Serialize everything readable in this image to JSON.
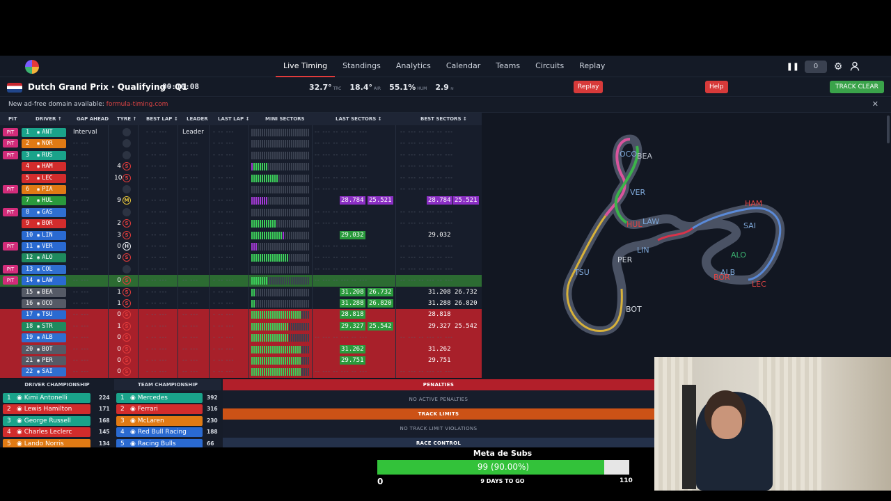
{
  "nav": {
    "links": [
      "Live Timing",
      "Standings",
      "Analytics",
      "Calendar",
      "Teams",
      "Circuits",
      "Replay"
    ],
    "active": "Live Timing",
    "counter": "0"
  },
  "session": {
    "title": "Dutch Grand Prix · Qualifying · Q1",
    "clock": "00:16:08",
    "track_temp": "32.7°",
    "track_label": "TRC",
    "air_temp": "18.4°",
    "air_label": "AIR",
    "humidity": "55.1%",
    "humidity_label": "HUM",
    "wind": "2.9",
    "replay_btn": "Replay",
    "help_btn": "Help",
    "flag_btn": "TRACK CLEAR"
  },
  "banner": {
    "text": "New ad-free domain available:",
    "link": "formula-timing.com"
  },
  "timing_headers": {
    "pit": "PIT",
    "driver": "DRIVER ↑",
    "gap": "GAP AHEAD",
    "tyre": "TYRE ↑",
    "best_lap": "BEST LAP ↕",
    "leader": "LEADER",
    "last_lap": "LAST LAP ↕",
    "mini": "MINI SECTORS",
    "last_sectors": "LAST SECTORS ↕",
    "best_sectors": "BEST SECTORS ↕"
  },
  "timing_rows": [
    {
      "pit": true,
      "pos": "1",
      "code": "ANT",
      "color": "#1aa38a",
      "gap": "Interval",
      "leader": "Leader",
      "laps": "",
      "tyre": "none",
      "mini": "",
      "ls": [
        "",
        ""
      ],
      "bs": [
        "",
        ""
      ],
      "row": ""
    },
    {
      "pit": true,
      "pos": "2",
      "code": "NOR",
      "color": "#e07a14",
      "gap": "",
      "leader": "",
      "laps": "",
      "tyre": "none",
      "mini": "",
      "ls": [
        "",
        ""
      ],
      "bs": [
        "",
        ""
      ],
      "row": ""
    },
    {
      "pit": true,
      "pos": "3",
      "code": "RUS",
      "color": "#1aa38a",
      "gap": "",
      "leader": "",
      "laps": "",
      "tyre": "none",
      "mini": "",
      "ls": [
        "",
        ""
      ],
      "bs": [
        "",
        ""
      ],
      "row": ""
    },
    {
      "pit": false,
      "pos": "4",
      "code": "HAM",
      "color": "#d22c2c",
      "gap": "",
      "leader": "",
      "laps": "4",
      "tyre": "S",
      "mini": "pggggggg",
      "ls": [
        "",
        ""
      ],
      "bs": [
        "",
        ""
      ],
      "row": ""
    },
    {
      "pit": false,
      "pos": "5",
      "code": "LEC",
      "color": "#d22c2c",
      "gap": "",
      "leader": "",
      "laps": "10",
      "tyre": "S",
      "mini": "ggggggggggggg",
      "ls": [
        "",
        ""
      ],
      "bs": [
        "",
        ""
      ],
      "row": ""
    },
    {
      "pit": true,
      "pos": "6",
      "code": "PIA",
      "color": "#e07a14",
      "gap": "",
      "leader": "",
      "laps": "",
      "tyre": "none",
      "mini": "",
      "ls": [
        "",
        ""
      ],
      "bs": [
        "",
        ""
      ],
      "row": ""
    },
    {
      "pit": false,
      "pos": "7",
      "code": "HUL",
      "color": "#2a9a3c",
      "gap": "",
      "leader": "",
      "laps": "9",
      "tyre": "M",
      "mini": "pppppppp",
      "ls": [
        "28.784",
        "25.521"
      ],
      "ls_c": [
        "p",
        "p"
      ],
      "bs": [
        "28.784",
        "25.521"
      ],
      "bs_c": [
        "p",
        "p"
      ],
      "row": ""
    },
    {
      "pit": true,
      "pos": "8",
      "code": "GAS",
      "color": "#2f6fd1",
      "gap": "",
      "leader": "",
      "laps": "",
      "tyre": "none",
      "mini": "",
      "ls": [
        "",
        ""
      ],
      "bs": [
        "",
        ""
      ],
      "row": ""
    },
    {
      "pit": false,
      "pos": "9",
      "code": "BOR",
      "color": "#d22c2c",
      "gap": "",
      "leader": "",
      "laps": "2",
      "tyre": "S",
      "mini": "gggggggggggg",
      "ls": [
        "",
        ""
      ],
      "bs": [
        "",
        ""
      ],
      "row": ""
    },
    {
      "pit": false,
      "pos": "10",
      "code": "LIN",
      "color": "#2a6ad1",
      "gap": "",
      "leader": "",
      "laps": "3",
      "tyre": "S",
      "mini": "gggggggggggggggp",
      "ls": [
        "29.032",
        ""
      ],
      "ls_c": [
        "g",
        ""
      ],
      "bs": [
        "29.032",
        ""
      ],
      "row": ""
    },
    {
      "pit": true,
      "pos": "11",
      "code": "VER",
      "color": "#2a6ad1",
      "gap": "",
      "leader": "",
      "laps": "0",
      "tyre": "H",
      "mini": "ppp",
      "ls": [
        "",
        ""
      ],
      "bs": [
        "",
        ""
      ],
      "row": ""
    },
    {
      "pit": false,
      "pos": "12",
      "code": "ALO",
      "color": "#1f8a5e",
      "gap": "",
      "leader": "",
      "laps": "0",
      "tyre": "S",
      "mini": "gggggggggggggggggg",
      "ls": [
        "",
        ""
      ],
      "bs": [
        "",
        ""
      ],
      "row": ""
    },
    {
      "pit": true,
      "pos": "13",
      "code": "COL",
      "color": "#2f6fd1",
      "gap": "",
      "leader": "",
      "laps": "",
      "tyre": "none",
      "mini": "",
      "ls": [
        "",
        ""
      ],
      "bs": [
        "",
        ""
      ],
      "row": ""
    },
    {
      "pit": true,
      "pos": "14",
      "code": "LAW",
      "color": "#2a6ad1",
      "gap": "",
      "leader": "",
      "laps": "0",
      "tyre": "S",
      "mini": "gggggggg",
      "ls": [
        "",
        ""
      ],
      "bs": [
        "",
        ""
      ],
      "row": "sel"
    },
    {
      "pit": false,
      "pos": "15",
      "code": "BEA",
      "color": "#555a66",
      "gap": "",
      "leader": "",
      "laps": "1",
      "tyre": "S",
      "mini": "gg",
      "ls": [
        "31.208",
        "26.732"
      ],
      "ls_c": [
        "g",
        "g"
      ],
      "bs": [
        "31.208",
        "26.732"
      ],
      "row": ""
    },
    {
      "pit": false,
      "pos": "16",
      "code": "OCO",
      "color": "#555a66",
      "gap": "",
      "leader": "",
      "laps": "1",
      "tyre": "S",
      "mini": "gg",
      "ls": [
        "31.288",
        "26.820"
      ],
      "ls_c": [
        "g",
        "g"
      ],
      "bs": [
        "31.288",
        "26.820"
      ],
      "row": ""
    },
    {
      "pit": false,
      "pos": "17",
      "code": "TSU",
      "color": "#2a6ad1",
      "gap": "",
      "leader": "",
      "laps": "0",
      "tyre": "S",
      "mini": "gggggggggggggggggggggggg",
      "ls": [
        "28.818",
        ""
      ],
      "ls_c": [
        "g",
        ""
      ],
      "bs": [
        "28.818",
        ""
      ],
      "row": "red"
    },
    {
      "pit": false,
      "pos": "18",
      "code": "STR",
      "color": "#1f8a5e",
      "gap": "",
      "leader": "",
      "laps": "1",
      "tyre": "S",
      "mini": "gggggggggggggggggg",
      "ls": [
        "29.327",
        "25.542"
      ],
      "ls_c": [
        "g",
        "g"
      ],
      "bs": [
        "29.327",
        "25.542"
      ],
      "row": "red"
    },
    {
      "pit": false,
      "pos": "19",
      "code": "ALB",
      "color": "#2f6fd1",
      "gap": "",
      "leader": "",
      "laps": "0",
      "tyre": "S",
      "mini": "gggggggggggggggggg",
      "ls": [
        "",
        ""
      ],
      "bs": [
        "",
        ""
      ],
      "row": "red"
    },
    {
      "pit": false,
      "pos": "20",
      "code": "BOT",
      "color": "#555a66",
      "gap": "",
      "leader": "",
      "laps": "0",
      "tyre": "S",
      "mini": "gggggggggggggggggggggggg",
      "ls": [
        "31.262",
        ""
      ],
      "ls_c": [
        "g",
        ""
      ],
      "bs": [
        "31.262",
        ""
      ],
      "row": "red"
    },
    {
      "pit": false,
      "pos": "21",
      "code": "PER",
      "color": "#555a66",
      "gap": "",
      "leader": "",
      "laps": "0",
      "tyre": "S",
      "mini": "gggggggggggggggggggggggg",
      "ls": [
        "29.751",
        ""
      ],
      "ls_c": [
        "g",
        ""
      ],
      "bs": [
        "29.751",
        ""
      ],
      "row": "red"
    },
    {
      "pit": false,
      "pos": "22",
      "code": "SAI",
      "color": "#2f6fd1",
      "gap": "",
      "leader": "",
      "laps": "0",
      "tyre": "S",
      "mini": "gggggggggggggggggggggggg",
      "ls": [
        "",
        ""
      ],
      "bs": [
        "",
        ""
      ],
      "row": "red"
    }
  ],
  "track_labels": [
    {
      "t": "OCO",
      "c": "#7fa8d9"
    },
    {
      "t": "BEA",
      "c": "#b7bcc6"
    },
    {
      "t": "VER",
      "c": "#7fa8d9"
    },
    {
      "t": "HAM",
      "c": "#e04444"
    },
    {
      "t": "SAI",
      "c": "#7fa8d9"
    },
    {
      "t": "LAW",
      "c": "#7fa8d9"
    },
    {
      "t": "HUL",
      "c": "#e04444"
    },
    {
      "t": "LIN",
      "c": "#7fa8d9"
    },
    {
      "t": "PER",
      "c": "#d6dbe3"
    },
    {
      "t": "ALO",
      "c": "#3cb371"
    },
    {
      "t": "TSU",
      "c": "#7fa8d9"
    },
    {
      "t": "ALB",
      "c": "#7fa8d9"
    },
    {
      "t": "BOR",
      "c": "#e04444"
    },
    {
      "t": "LEC",
      "c": "#e04444"
    },
    {
      "t": "BOT",
      "c": "#d6dbe3"
    }
  ],
  "driver_championship": {
    "title": "DRIVER CHAMPIONSHIP",
    "rows": [
      {
        "pos": "1",
        "name": "Kimi Antonelli",
        "pts": "224",
        "color": "#1aa38a"
      },
      {
        "pos": "2",
        "name": "Lewis Hamilton",
        "pts": "171",
        "color": "#d22c2c"
      },
      {
        "pos": "3",
        "name": "George Russell",
        "pts": "168",
        "color": "#1aa38a"
      },
      {
        "pos": "4",
        "name": "Charles Leclerc",
        "pts": "145",
        "color": "#d22c2c"
      },
      {
        "pos": "5",
        "name": "Lando Norris",
        "pts": "134",
        "color": "#e07a14"
      }
    ]
  },
  "team_championship": {
    "title": "TEAM CHAMPIONSHIP",
    "rows": [
      {
        "pos": "1",
        "name": "Mercedes",
        "pts": "392",
        "color": "#1aa38a"
      },
      {
        "pos": "2",
        "name": "Ferrari",
        "pts": "316",
        "color": "#d22c2c"
      },
      {
        "pos": "3",
        "name": "McLaren",
        "pts": "230",
        "color": "#e07a14"
      },
      {
        "pos": "4",
        "name": "Red Bull Racing",
        "pts": "188",
        "color": "#2a6ad1"
      },
      {
        "pos": "5",
        "name": "Racing Bulls",
        "pts": "66",
        "color": "#2a6ad1"
      }
    ]
  },
  "messages": {
    "penalties": "PENALTIES",
    "no_penalties": "NO ACTIVE PENALTIES",
    "track_limits": "TRACK LIMITS",
    "no_track_limits": "NO TRACK LIMIT VIOLATIONS",
    "race_control": "RACE CONTROL"
  },
  "sub_goal": {
    "title": "Meta de Subs",
    "progress_text": "99 (90.00%)",
    "progress": 0.9,
    "min": "0",
    "max": "110",
    "days": "9 DAYS TO GO"
  }
}
